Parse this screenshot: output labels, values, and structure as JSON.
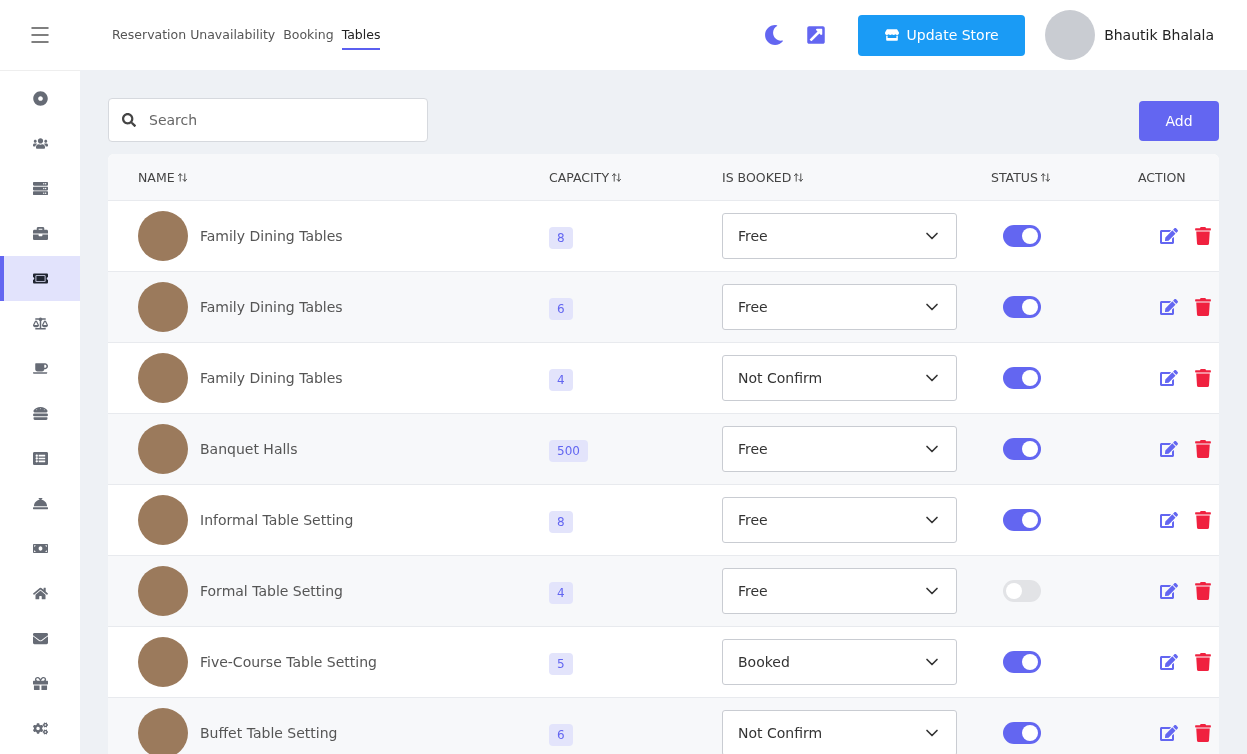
{
  "header": {
    "tabs": [
      {
        "label": "Reservation Unavailability",
        "selected": false
      },
      {
        "label": "Booking",
        "selected": false
      },
      {
        "label": "Tables",
        "selected": true
      }
    ],
    "update_button": "Update Store",
    "user_name": "Bhautik Bhalala"
  },
  "sidebar": {
    "items": [
      {
        "selected": false
      },
      {
        "selected": false
      },
      {
        "selected": false
      },
      {
        "selected": false
      },
      {
        "selected": true
      },
      {
        "selected": false
      },
      {
        "selected": false
      },
      {
        "selected": false
      },
      {
        "selected": false
      },
      {
        "selected": false
      },
      {
        "selected": false
      },
      {
        "selected": false
      },
      {
        "selected": false
      },
      {
        "selected": false
      },
      {
        "selected": false
      }
    ]
  },
  "search": {
    "placeholder": "Search"
  },
  "add_button": "Add",
  "table": {
    "columns": [
      {
        "label": "NAME",
        "sortable": true
      },
      {
        "label": "CAPACITY",
        "sortable": true
      },
      {
        "label": "IS BOOKED",
        "sortable": true
      },
      {
        "label": "STATUS",
        "sortable": true
      },
      {
        "label": "ACTION",
        "sortable": false
      }
    ],
    "rows": [
      {
        "name": "Family Dining Tables",
        "capacity": "8",
        "booked": "Free",
        "on": true
      },
      {
        "name": "Family Dining Tables",
        "capacity": "6",
        "booked": "Free",
        "on": true
      },
      {
        "name": "Family Dining Tables",
        "capacity": "4",
        "booked": "Not Confirm",
        "on": true
      },
      {
        "name": "Banquet Halls",
        "capacity": "500",
        "booked": "Free",
        "on": true
      },
      {
        "name": "Informal Table Setting",
        "capacity": "8",
        "booked": "Free",
        "on": true
      },
      {
        "name": "Formal Table Setting",
        "capacity": "4",
        "booked": "Free",
        "on": false
      },
      {
        "name": "Five-Course Table Setting",
        "capacity": "5",
        "booked": "Booked",
        "on": true
      },
      {
        "name": "Buffet Table Setting",
        "capacity": "6",
        "booked": "Not Confirm",
        "on": true
      }
    ]
  }
}
